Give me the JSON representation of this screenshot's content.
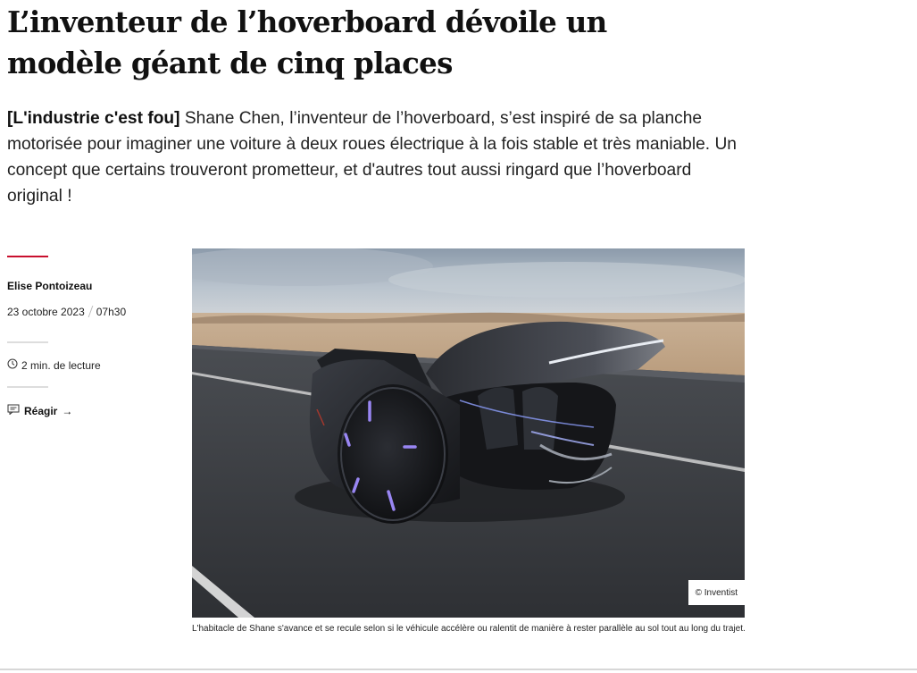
{
  "article": {
    "title": "L’inventeur de l’hoverboard dévoile un modèle géant de cinq places",
    "kicker": "[L'industrie c'est fou]",
    "lead": " Shane Chen, l’inventeur de l’hoverboard, s’est inspiré de sa planche motorisée pour imaginer une voiture à deux roues électrique à la fois stable et très maniable. Un concept que certains trouveront prometteur, et d'autres tout aussi ringard que l’hoverboard original !"
  },
  "meta": {
    "author": "Elise Pontoizeau",
    "date": "23 octobre 2023",
    "time": "07h30",
    "reading_time": "2 min. de lecture",
    "react_label": "Réagir",
    "accent_color": "#c8102e"
  },
  "figure": {
    "credit": "© Inventist",
    "caption": "L'habitacle de Shane s'avance et se recule selon si le véhicule accélère ou ralentit de manière à rester parallèle au sol tout au long du trajet."
  },
  "icons": {
    "clock": "clock-icon",
    "comment": "comment-icon",
    "arrow": "arrow-right-icon"
  }
}
